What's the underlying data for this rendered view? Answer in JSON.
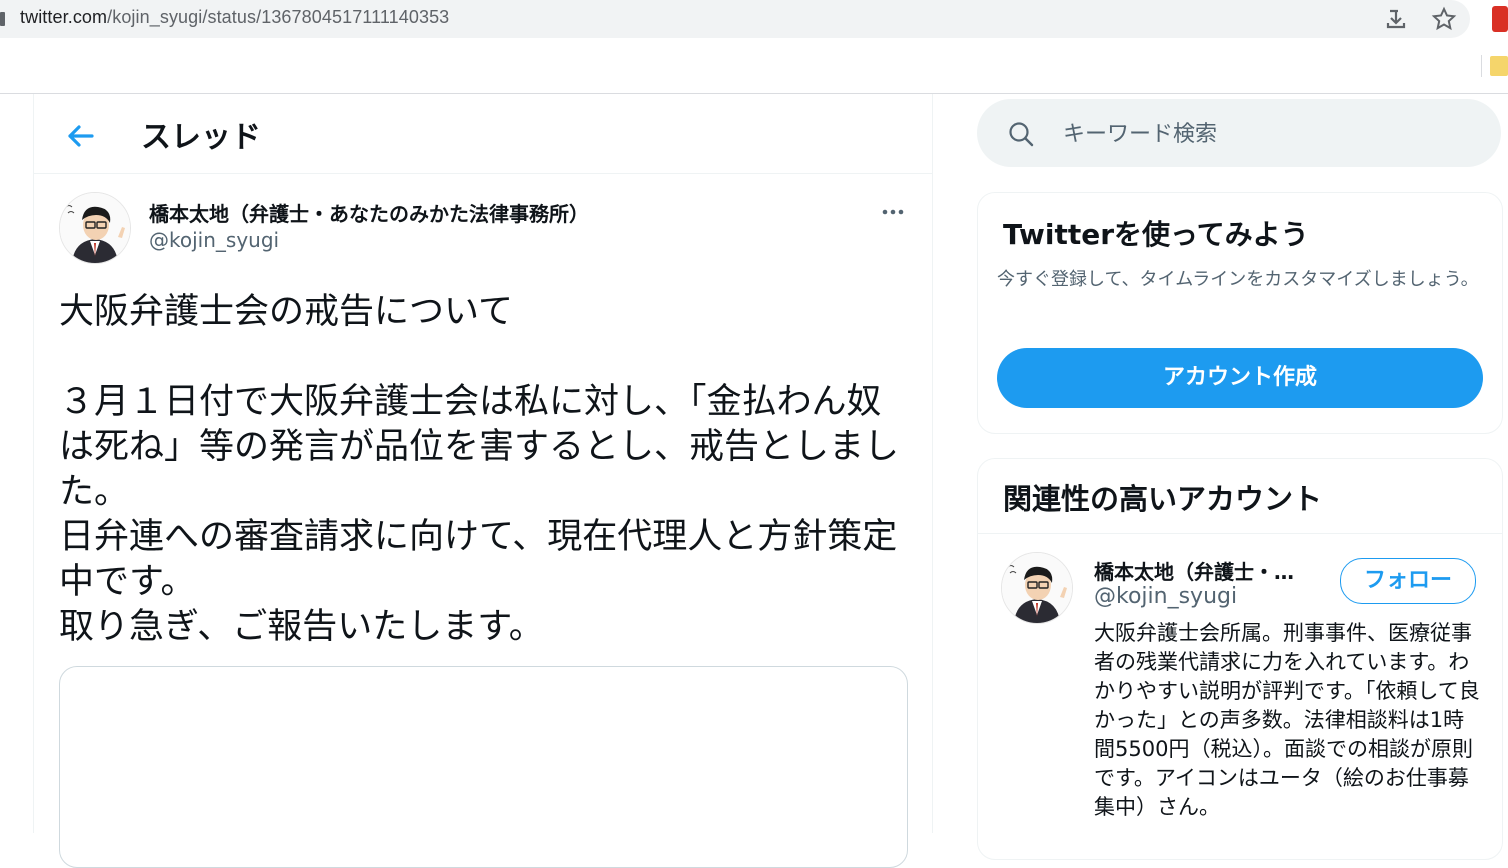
{
  "browser": {
    "url_host": "twitter.com",
    "url_path": "/kojin_syugi/status/1367804517111140353"
  },
  "header": {
    "title": "スレッド"
  },
  "tweet": {
    "author_name": "橋本太地（弁護士・あなたのみかた法律事務所）",
    "author_handle": "@kojin_syugi",
    "text": "大阪弁護士会の戒告について\n\n３月１日付で大阪弁護士会は私に対し、「金払わん奴は死ね」等の発言が品位を害するとし、戒告としました。\n日弁連への審査請求に向けて、現在代理人と方針策定中です。\n取り急ぎ、ご報告いたします。"
  },
  "sidebar": {
    "search_placeholder": "キーワード検索",
    "signup": {
      "title": "Twitterを使ってみよう",
      "description": "今すぐ登録して、タイムラインをカスタマイズしましょう。",
      "button": "アカウント作成"
    },
    "related": {
      "title": "関連性の高いアカウント",
      "account": {
        "name": "橋本太地（弁護士・…",
        "handle": "@kojin_syugi",
        "follow": "フォロー",
        "bio": "大阪弁護士会所属。刑事事件、医療従事者の残業代請求に力を入れています。わかりやすい説明が評判です。「依頼して良かった」との声多数。法律相談料は1時間5500円（税込）。面談での相談が原則です。アイコンはユータ（絵のお仕事募集中）さん。"
      }
    }
  },
  "colors": {
    "accent": "#1d9bf0",
    "text_primary": "#0f1419",
    "text_secondary": "#536471",
    "border": "#eff3f4"
  },
  "icons": {
    "back": "arrow-left-icon",
    "more": "more-horizontal-icon",
    "search": "search-icon",
    "download": "download-icon",
    "bookmark": "star-icon"
  }
}
